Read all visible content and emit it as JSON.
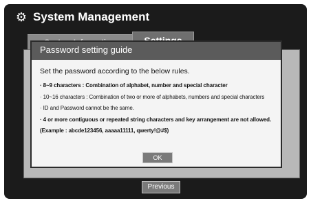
{
  "window": {
    "title": "System Management",
    "icon": "gear-icon"
  },
  "tabs": [
    {
      "label": "System Information",
      "active": false
    },
    {
      "label": "Settings",
      "active": true
    }
  ],
  "dialog": {
    "title": "Password setting guide",
    "intro": "Set the password according to the below rules.",
    "rules": [
      "· 8~9 characters : Combination of alphabet, number and special character",
      "· 10~16 characters : Combination of two or more of alphabets, numbers and special characters",
      "· ID and Password cannot be the same.",
      "· 4 or more contiguous or repeated string characters and key arrangement are not allowed.",
      "(Example : abcde123456, aaaaa11111, qwerty!@#$)"
    ],
    "ok_label": "OK"
  },
  "footer": {
    "previous_label": "Previous"
  }
}
